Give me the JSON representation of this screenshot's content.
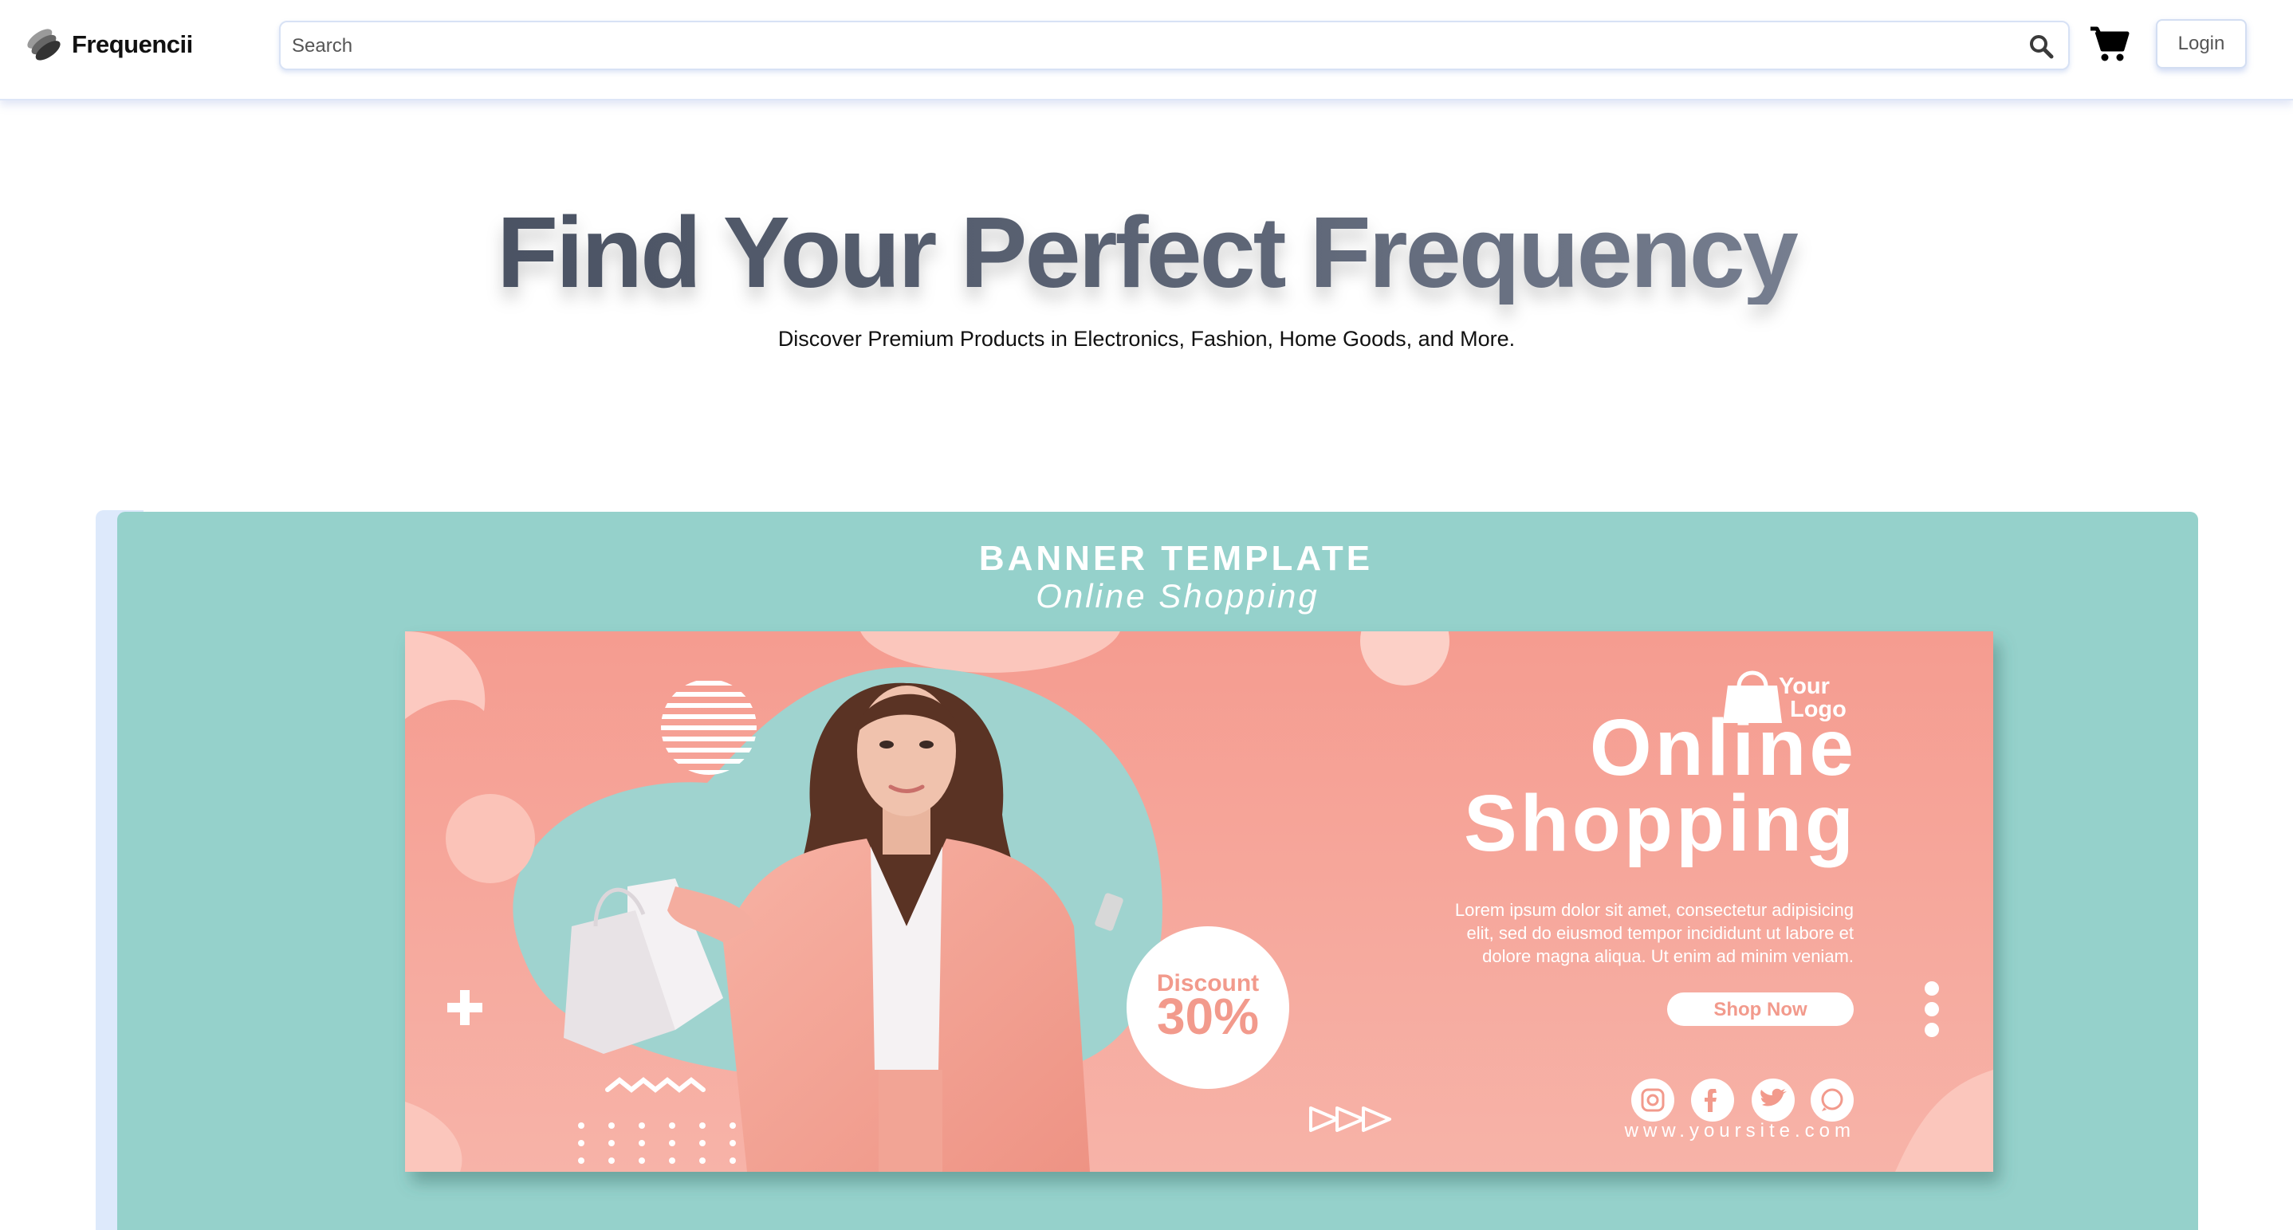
{
  "navbar": {
    "brand_name": "Frequencii",
    "search_placeholder": "Search",
    "login_label": "Login"
  },
  "hero": {
    "title": "Find Your Perfect Frequency",
    "subtitle": "Discover Premium Products in Electronics, Fashion, Home Goods, and More."
  },
  "banner": {
    "heading": "BANNER TEMPLATE",
    "subheading": "Online Shopping",
    "logo_line1": "Your",
    "logo_line2": "Logo",
    "title_line1": "Online",
    "title_line2": "Shopping",
    "body_line1": "Lorem ipsum dolor sit amet, consectetur adipisicing",
    "body_line2": "elit, sed do eiusmod tempor incididunt ut labore et",
    "body_line3": "dolore magna aliqua. Ut enim ad minim veniam.",
    "cta_label": "Shop Now",
    "discount_label": "Discount",
    "discount_value": "30%",
    "website": "www.yoursite.com",
    "social_icons": [
      "instagram-icon",
      "facebook-icon",
      "twitter-icon",
      "whatsapp-icon"
    ]
  },
  "colors": {
    "banner_background": "#95d1cb",
    "flyer_pink": "#f6a89a",
    "accent_white": "#ffffff"
  }
}
